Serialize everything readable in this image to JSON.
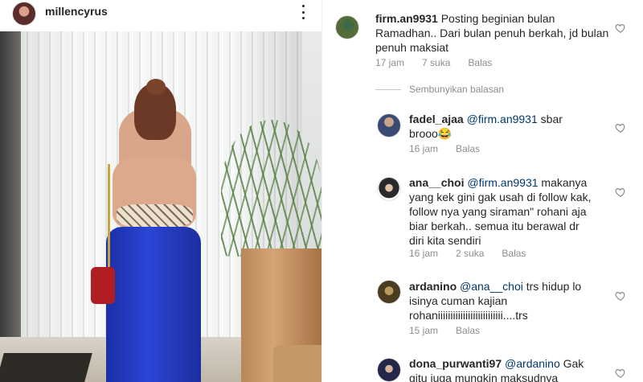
{
  "post": {
    "username": "millencyrus"
  },
  "comments": [
    {
      "username": "firm.an9931",
      "text": "Posting beginian bulan Ramadhan.. Dari bulan penuh berkah, jd bulan penuh maksiat",
      "time": "17 jam",
      "likes": "7 suka",
      "reply": "Balas"
    }
  ],
  "hide_replies_label": "Sembunyikan balasan",
  "replies": [
    {
      "username": "fadel_ajaa",
      "mention": "@firm.an9931",
      "text": " sbar brooo😂",
      "time": "16 jam",
      "likes": "",
      "reply": "Balas"
    },
    {
      "username": "ana__choi",
      "mention": "@firm.an9931",
      "text": " makanya yang kek gini gak usah di follow kak, follow nya yang siraman\" rohani aja biar berkah.. semua itu berawal dr diri kita sendiri",
      "time": "16 jam",
      "likes": "2 suka",
      "reply": "Balas"
    },
    {
      "username": "ardanino",
      "mention": "@ana__choi",
      "text": " trs hidup lo isinya cuman kajian rohaniiiiiiiiiiiiiiiiiiiiiiiiii....trs",
      "time": "15 jam",
      "likes": "",
      "reply": "Balas"
    },
    {
      "username": "dona_purwanti97",
      "mention": "@ardanino",
      "text": " Gak gitu juga mungkin maksudnya",
      "time": "",
      "likes": "",
      "reply": ""
    }
  ],
  "colors": {
    "text": "#262626",
    "meta": "#8e8e8e",
    "mention": "#00376b"
  },
  "icons": [
    "more-options-icon",
    "heart-icon"
  ]
}
